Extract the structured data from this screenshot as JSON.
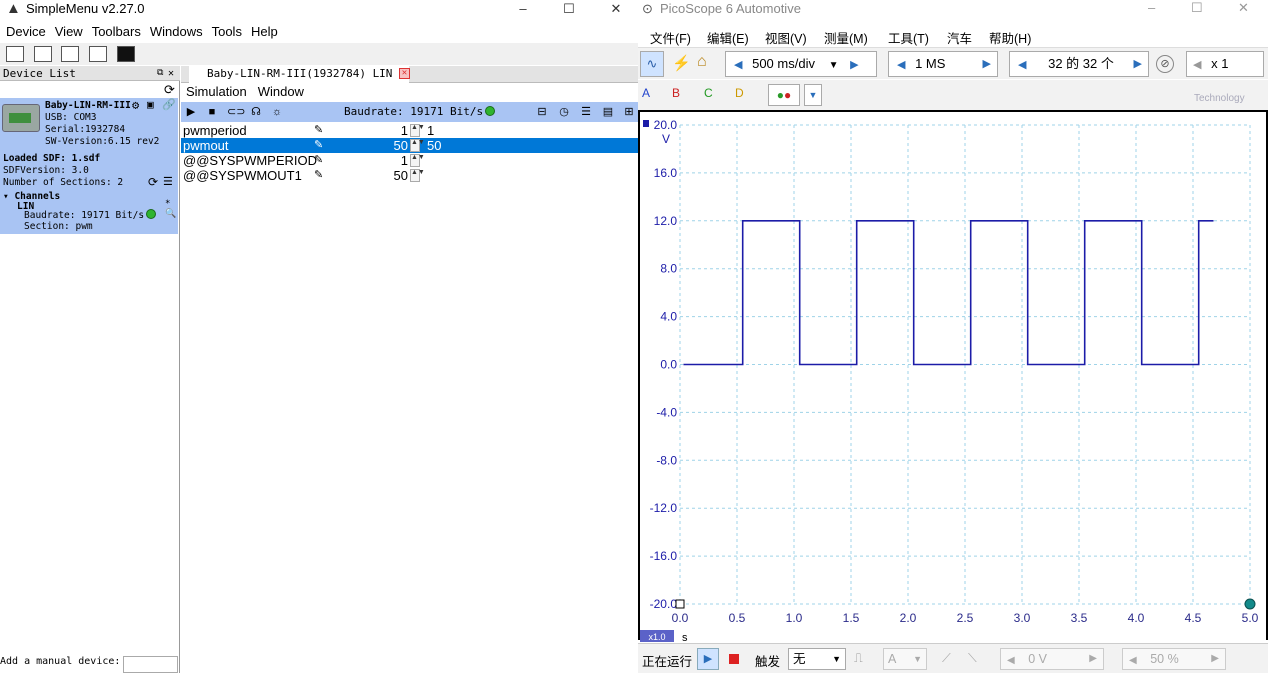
{
  "simplemenu": {
    "title": "SimpleMenu v2.27.0",
    "window_controls": {
      "minimize": "–",
      "maximize": "☐",
      "close": "✕"
    },
    "menu": [
      "Device",
      "View",
      "Toolbars",
      "Windows",
      "Tools",
      "Help"
    ],
    "device_list": {
      "header": "Device List",
      "device_name": "Baby-LIN-RM-III",
      "usb": "USB: COM3",
      "serial": "Serial:1932784",
      "sw_version": "SW-Version:6.15 rev2",
      "loaded_sdf": "Loaded SDF: 1.sdf",
      "sdf_version": "SDFVersion: 3.0",
      "num_sections": "Number of Sections: 2",
      "channels": "Channels",
      "channel_lin": "LIN",
      "channel_baud": "Baudrate: 19171 Bit/s",
      "section": "Section: pwm",
      "manual_device": "Add a manual device:"
    },
    "tab": {
      "label": "Baby-LIN-RM-III(1932784) LIN"
    },
    "sim_menu": [
      "Simulation",
      "Window"
    ],
    "baudrate": "Baudrate: 19171 Bit/s",
    "signals": [
      {
        "name": "pwmperiod",
        "value": "1",
        "value2": "1",
        "selected": false
      },
      {
        "name": "pwmout",
        "value": "50",
        "value2": "50",
        "selected": true
      },
      {
        "name": "@@SYSPWMPERIOD",
        "value": "1",
        "value2": "",
        "selected": false
      },
      {
        "name": "@@SYSPWMOUT1",
        "value": "50",
        "value2": "",
        "selected": false
      }
    ]
  },
  "picoscope": {
    "title": "PicoScope 6 Automotive",
    "menu": [
      "文件(F)",
      "编辑(E)",
      "视图(V)",
      "测量(M)",
      "工具(T)",
      "汽车",
      "帮助(H)"
    ],
    "timebase": "500 ms/div",
    "samples": "1 MS",
    "buffer": "32 的 32 个",
    "zoom": "x 1",
    "channels": [
      "A",
      "B",
      "C",
      "D"
    ],
    "logo_text": "Technology",
    "status": {
      "running": "正在运行",
      "trigger_label": "触发",
      "trigger_mode": "无",
      "channel": "A",
      "level": "0 V",
      "percent": "50 %"
    },
    "axis_unit_v": "V",
    "axis_unit_s": "s",
    "x_scale_badge": "x1.0",
    "accent": "#1c1ca8"
  },
  "chart_data": {
    "type": "line",
    "title": "",
    "ylabel": "V",
    "xlabel": "s",
    "ylim": [
      -20.0,
      20.0
    ],
    "xlim": [
      0.0,
      5.0
    ],
    "yticks": [
      "20.0",
      "16.0",
      "12.0",
      "8.0",
      "4.0",
      "0.0",
      "-4.0",
      "-8.0",
      "-12.0",
      "-16.0",
      "-20.0"
    ],
    "xticks": [
      "0.0",
      "0.5",
      "1.0",
      "1.5",
      "2.0",
      "2.5",
      "3.0",
      "3.5",
      "4.0",
      "4.5",
      "5.0"
    ],
    "grid": true,
    "series": [
      {
        "x": [
          0.03,
          0.55,
          0.55,
          1.05,
          1.05,
          1.55,
          1.55,
          2.05,
          2.05,
          2.55,
          2.55,
          3.05,
          3.05,
          3.55,
          3.55,
          4.05,
          4.05,
          4.55,
          4.55,
          4.68
        ],
        "y": [
          0.0,
          0.0,
          12.0,
          12.0,
          0.0,
          0.0,
          12.0,
          12.0,
          0.0,
          0.0,
          12.0,
          12.0,
          0.0,
          0.0,
          12.0,
          12.0,
          0.0,
          0.0,
          12.0,
          12.0
        ]
      }
    ]
  }
}
